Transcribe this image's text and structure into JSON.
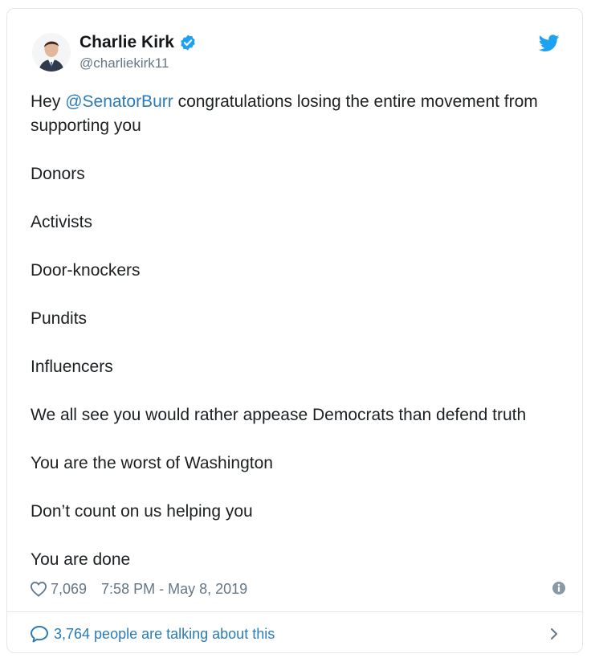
{
  "tweet": {
    "author_name": "Charlie Kirk",
    "author_handle": "@charliekirk11",
    "line1_prefix": "Hey ",
    "mention": "@SenatorBurr",
    "line1_suffix": " congratulations losing the entire movement from supporting you",
    "paragraphs": [
      "Donors",
      "Activists",
      "Door-knockers",
      "Pundits",
      "Influencers",
      "We all see you would rather appease Democrats than defend truth",
      "You are the worst of Washington",
      "Don’t count on us helping you",
      "You are done"
    ],
    "likes": "7,069",
    "timestamp": "7:58 PM - May 8, 2019",
    "talking": "3,764 people are talking about this"
  },
  "icons": {
    "verified": "verified-badge-icon",
    "bird": "twitter-bird-icon",
    "heart": "heart-icon",
    "info": "info-icon",
    "bubble": "speech-bubble-icon",
    "chevron": "chevron-right-icon"
  },
  "colors": {
    "brand": "#1da1f2",
    "link": "#2b7bb9",
    "text": "#1c2022",
    "muted": "#657786",
    "border": "#e1e8ed"
  }
}
